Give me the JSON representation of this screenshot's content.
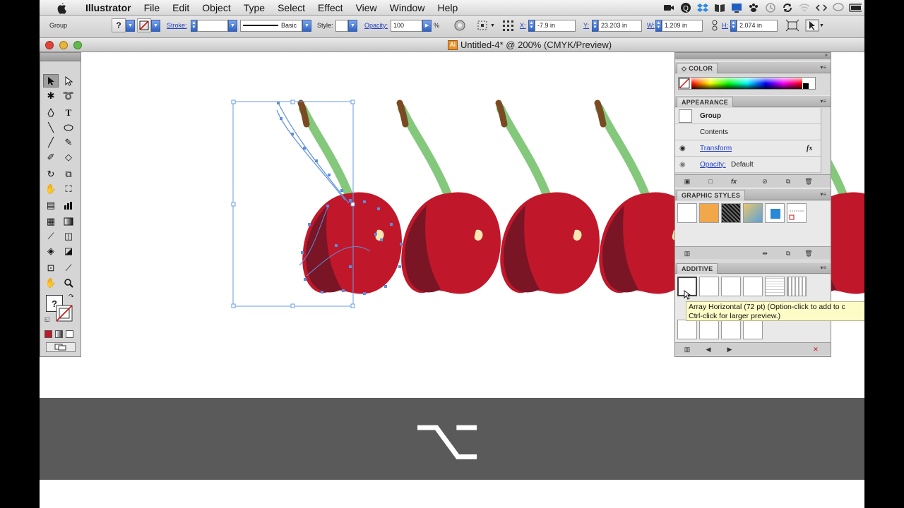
{
  "menubar": {
    "app_name": "Illustrator",
    "items": [
      "File",
      "Edit",
      "Object",
      "Type",
      "Select",
      "Effect",
      "View",
      "Window",
      "Help"
    ]
  },
  "controlbar": {
    "selection_type": "Group",
    "stroke_label": "Stroke:",
    "brush_label": "Basic",
    "style_label": "Style:",
    "opacity_label": "Opacity:",
    "opacity_value": "100",
    "opacity_unit": "%",
    "x_label": "X:",
    "x_value": "-7.9 in",
    "y_label": "Y:",
    "y_value": "23.203 in",
    "w_label": "W:",
    "w_value": "1.209 in",
    "h_label": "H:",
    "h_value": "2.074 in"
  },
  "document": {
    "title": "Untitled-4* @ 200% (CMYK/Preview)",
    "icon_label": "Ai"
  },
  "panels": {
    "color": {
      "title": "COLOR"
    },
    "appearance": {
      "title": "APPEARANCE",
      "object": "Group",
      "contents": "Contents",
      "effect": "Transform",
      "effect_fx": "fx",
      "opacity_label": "Opacity:",
      "opacity_value": "Default"
    },
    "graphic_styles": {
      "title": "GRAPHIC STYLES"
    },
    "additive": {
      "title": "ADDITIVE"
    }
  },
  "tooltip": {
    "line1": "Array Horizontal (72 pt) (Option-click to add to c",
    "line2": "Ctrl-click for larger preview.)"
  },
  "tools": {
    "fill_stroke_unknown": "?"
  },
  "key_overlay": {
    "symbol": "⌥",
    "key_name": "option-key-icon"
  },
  "colors": {
    "cherry_red": "#c0182a",
    "cherry_dark": "#7a1526",
    "stem_green": "#84c87c",
    "stem_brown": "#7a4a22",
    "selection_blue": "#5b8ee0"
  }
}
